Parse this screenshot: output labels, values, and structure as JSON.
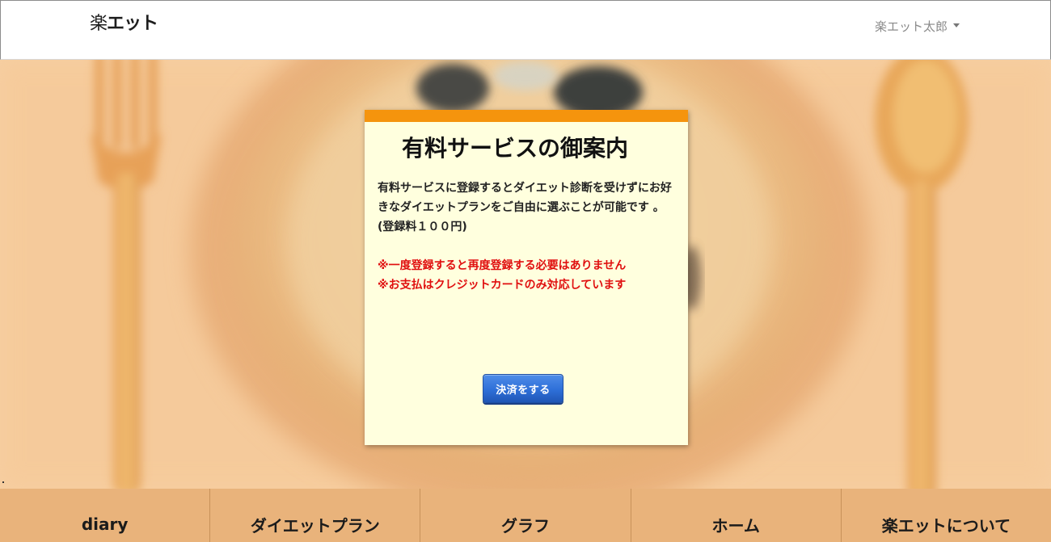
{
  "header": {
    "logo_mark": "楽",
    "logo_text": "エット",
    "user_name": "楽エット太郎"
  },
  "card": {
    "title": "有料サービスの御案内",
    "description": "有料サービスに登録するとダイエット診断を受けずにお好きなダイエットプランをご自由に選ぶことが可能です 。(登録料１００円)",
    "notes": [
      "※一度登録すると再度登録する必要はありません",
      "※お支払はクレジットカードのみ対応しています"
    ],
    "pay_button_label": "決済をする"
  },
  "bottom_nav": {
    "items": [
      {
        "label": "diary"
      },
      {
        "label": "ダイエットプラン"
      },
      {
        "label": "グラフ"
      },
      {
        "label": "ホーム"
      },
      {
        "label": "楽エットについて"
      }
    ]
  },
  "colors": {
    "card_accent": "#f5940d",
    "card_background": "#ffffde",
    "note_text": "#e00f0f",
    "nav_background": "#e9b37b",
    "button_blue": "#2e6fd8"
  },
  "icons": {
    "user_menu_caret": "caret-down-icon"
  }
}
